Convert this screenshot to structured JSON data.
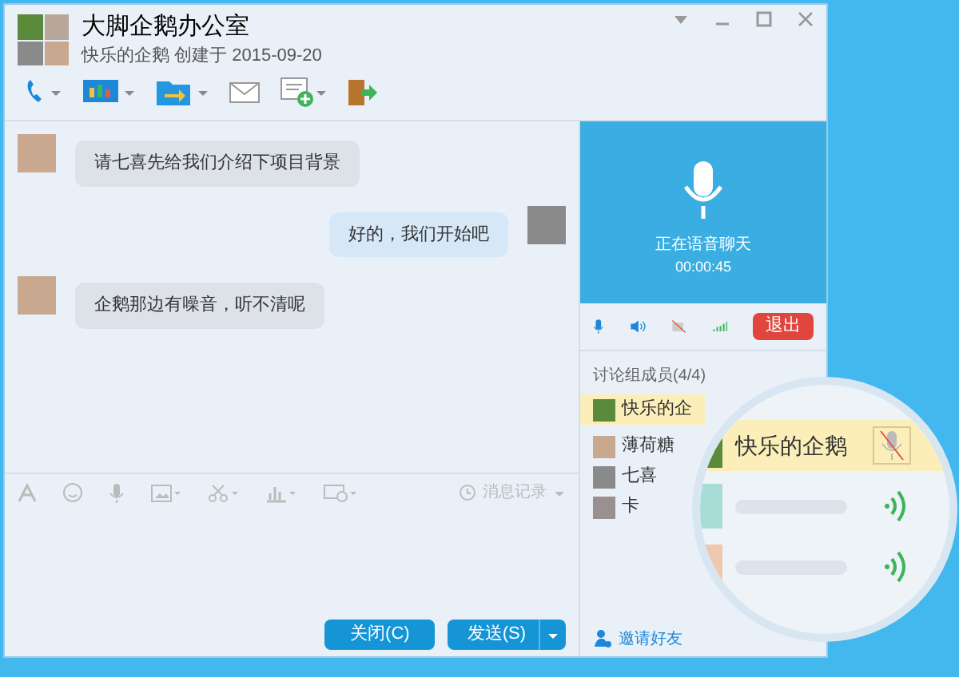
{
  "window": {
    "title": "大脚企鹅办公室",
    "subtitle": "快乐的企鹅 创建于 2015-09-20"
  },
  "messages": [
    {
      "kind": "received",
      "text": "请七喜先给我们介绍下项目背景"
    },
    {
      "kind": "sent",
      "text": "好的，我们开始吧"
    },
    {
      "kind": "received",
      "text": "企鹅那边有噪音，听不清呢"
    }
  ],
  "history_label": "消息记录",
  "buttons": {
    "close": "关闭(C)",
    "send": "发送(S)"
  },
  "voice": {
    "status": "正在语音聊天",
    "time": "00:00:45",
    "exit": "退出"
  },
  "members": {
    "title": "讨论组成员(4/4)",
    "items": [
      {
        "name": "快乐的企",
        "selected": true
      },
      {
        "name": "薄荷糖",
        "selected": false
      },
      {
        "name": "七喜",
        "selected": false
      },
      {
        "name": "卡",
        "selected": false
      }
    ]
  },
  "invite": "邀请好友",
  "magnifier": {
    "rows": [
      {
        "kind": "member",
        "name": "快乐的企鹅",
        "selected": true,
        "muted": true
      },
      {
        "kind": "speaking",
        "selected": false,
        "muted": false
      },
      {
        "kind": "speaking",
        "selected": false,
        "muted": false
      }
    ]
  }
}
